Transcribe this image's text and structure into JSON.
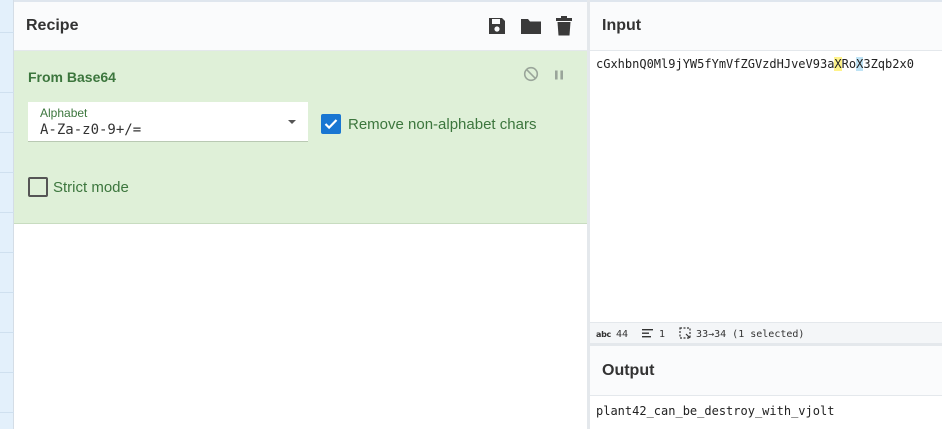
{
  "recipe": {
    "title": "Recipe",
    "icons": [
      "save-icon",
      "folder-icon",
      "trash-icon"
    ],
    "operation": {
      "name": "From Base64",
      "controls": [
        "disable-icon",
        "pause-icon"
      ],
      "alphabet": {
        "label": "Alphabet",
        "value": "A-Za-z0-9+/="
      },
      "remove_non_alphabet": {
        "label": "Remove non-alphabet chars",
        "checked": true
      },
      "strict_mode": {
        "label": "Strict mode",
        "checked": false
      }
    }
  },
  "input": {
    "title": "Input",
    "text_before": "cGxhbnQ0Ml9jYW5fYmVfZGVzdHJveV93a",
    "text_sel1": "X",
    "text_mid": "Ro",
    "text_sel2": "X",
    "text_after": "3Zqb2x0",
    "status": {
      "length_label": "abc",
      "length": "44",
      "lines": "1",
      "selection": "33→34 (1 selected)"
    }
  },
  "output": {
    "title": "Output",
    "text": "plant42_can_be_destroy_with_vjolt"
  },
  "colors": {
    "accent": "#1976d2",
    "operation_bg": "#dff0d8",
    "operation_text": "#3c763d",
    "highlight_yellow": "#fff38a",
    "highlight_blue": "#bfe3f5"
  }
}
